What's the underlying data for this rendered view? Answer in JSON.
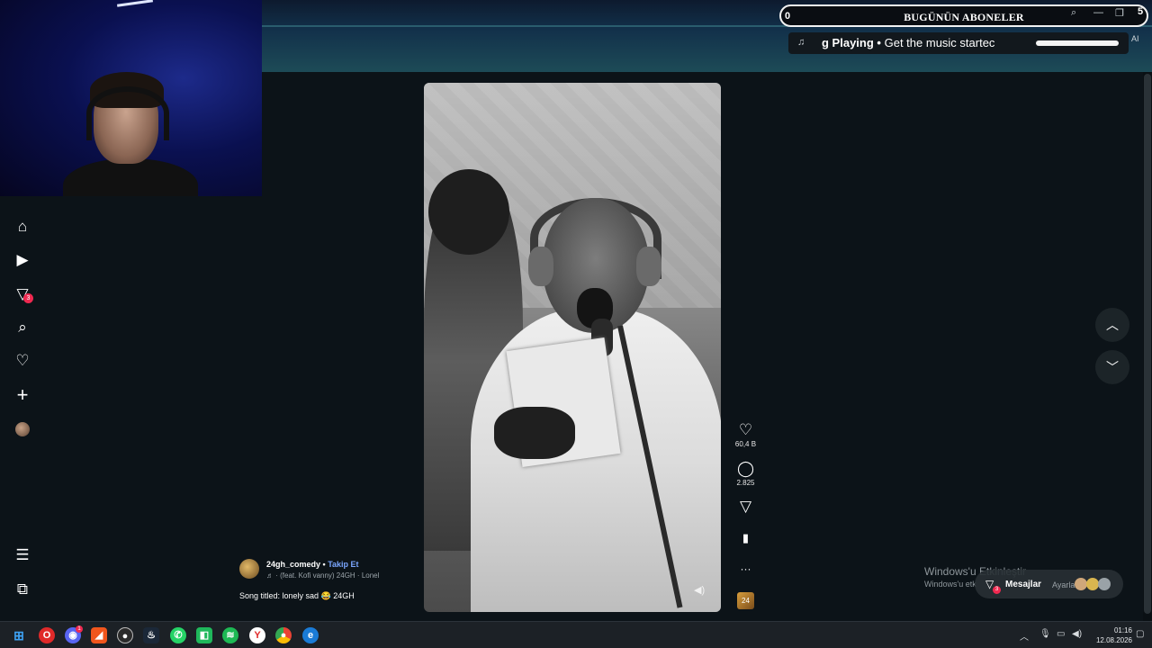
{
  "overlay": {
    "subscriber_count": "0",
    "subscriber_label": "BUGÜNÜN ABONELER",
    "subscriber_badge": "5",
    "music_note": "♫",
    "now_playing_label": "g Playing",
    "now_playing_separator": "•",
    "now_playing_text": "Get the music startec",
    "ai_label": "AI"
  },
  "sidebar": {
    "items": [
      {
        "name": "home",
        "glyph": "⌂"
      },
      {
        "name": "explore",
        "glyph": "▶"
      },
      {
        "name": "inbox",
        "glyph": "▽",
        "badge": "3"
      },
      {
        "name": "search",
        "glyph": "⌕"
      },
      {
        "name": "likes",
        "glyph": "♡"
      },
      {
        "name": "create",
        "glyph": "+"
      },
      {
        "name": "profile",
        "glyph": ""
      }
    ],
    "menu_glyph": "☰",
    "more_glyph": "⧉"
  },
  "video": {
    "mute_glyph": "◀)"
  },
  "actions": {
    "like_count": "60,4 B",
    "comment_count": "2.825",
    "like_glyph": "♡",
    "comment_glyph": "◯",
    "share_glyph": "▽",
    "save_glyph": "▮",
    "more_glyph": "···",
    "sound_label": "24"
  },
  "caption": {
    "username": "24gh_comedy",
    "separator": "•",
    "follow_label": "Takip Et",
    "music": "♬ · (feat. Kofi vanny) 24GH · Lonel",
    "description": "Song titled: lonely sad 😂 24GH"
  },
  "nav": {
    "up_glyph": "︿",
    "down_glyph": "﹀"
  },
  "watermark": {
    "title": "Windows'u Etkinleştir",
    "subtitle": "Windows'u etk"
  },
  "messages": {
    "label": "Mesajlar",
    "sub": "Ayarlar",
    "badge": "3"
  },
  "taskbar": {
    "time": "01:16",
    "date": "12.08.2026",
    "discord_badge": "1"
  },
  "colors": {
    "accent_red": "#ef2950",
    "follow_blue": "#7aa6ff",
    "background": "#0c1318"
  }
}
